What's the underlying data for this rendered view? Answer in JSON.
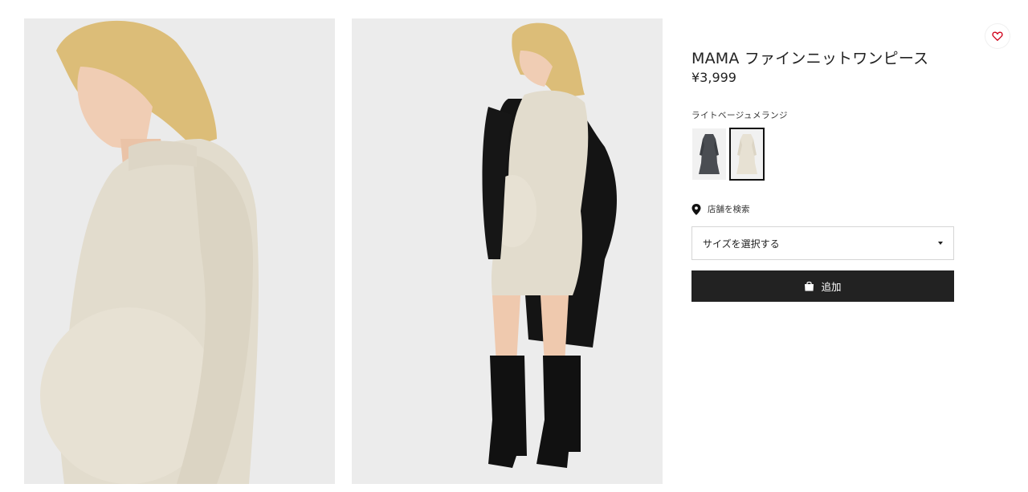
{
  "product": {
    "title": "MAMA ファインニットワンピース",
    "price": "¥3,999",
    "selected_color": "ライトベージュメランジ"
  },
  "images": [
    {
      "name": "product-photo-closeup",
      "icon": "model-closeup-image"
    },
    {
      "name": "product-photo-fullbody",
      "icon": "model-fullbody-image"
    }
  ],
  "swatches": [
    {
      "name": "dark-grey",
      "color": "#4a4d52",
      "selected": false
    },
    {
      "name": "light-beige-melange",
      "color": "#e7e1d3",
      "selected": true
    }
  ],
  "store_link": {
    "label": "店舗を検索",
    "icon": "location-pin-icon"
  },
  "size_select": {
    "placeholder": "サイズを選択する",
    "icon": "caret-down-icon"
  },
  "add_button": {
    "label": "追加",
    "icon": "shopping-bag-icon"
  },
  "wishlist": {
    "icon": "heart-icon",
    "color": "#d0021b"
  },
  "colors": {
    "button_bg": "#222222",
    "dress": "#e2dccd",
    "cardigan": "#141414",
    "hair": "#dcbd78"
  }
}
